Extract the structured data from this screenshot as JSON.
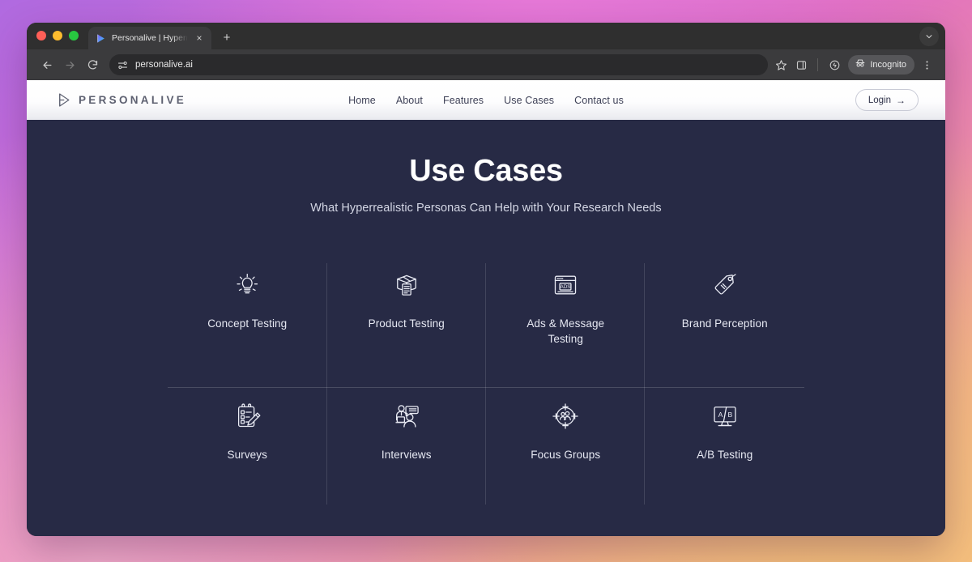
{
  "browser": {
    "window_controls": [
      "close",
      "minimize",
      "maximize"
    ],
    "tab": {
      "title": "Personalive | Hyperrealistic P",
      "favicon": "personalive-play-icon",
      "close_label": "×"
    },
    "new_tab_label": "+",
    "tab_list_chevron": "chevron-down-icon",
    "toolbar": {
      "back_label": "←",
      "forward_label": "→",
      "reload_label": "⟳",
      "site_settings_icon": "tune-icon",
      "url": "personalive.ai",
      "bookmark_icon": "star-icon",
      "side_panel_icon": "side-panel-icon",
      "extensions_icon": "extensions-icon",
      "incognito_label": "Incognito",
      "incognito_icon": "incognito-hat-icon",
      "menu_label": "⋮"
    }
  },
  "site": {
    "logo": {
      "mark": "play-triangle-icon",
      "text": "PERSONALIVE"
    },
    "nav": [
      {
        "label": "Home"
      },
      {
        "label": "About"
      },
      {
        "label": "Features"
      },
      {
        "label": "Use Cases"
      },
      {
        "label": "Contact us"
      }
    ],
    "login": {
      "label": "Login",
      "arrow": "→"
    }
  },
  "hero": {
    "title": "Use Cases",
    "subtitle": "What Hyperrealistic Personas Can Help with Your Research Needs"
  },
  "use_cases": [
    {
      "label": "Concept Testing",
      "icon": "lightbulb-icon"
    },
    {
      "label": "Product Testing",
      "icon": "box-clipboard-icon"
    },
    {
      "label": "Ads & Message Testing",
      "icon": "browser-ads-icon"
    },
    {
      "label": "Brand Perception",
      "icon": "price-tag-icon"
    },
    {
      "label": "Surveys",
      "icon": "clipboard-pencil-icon"
    },
    {
      "label": "Interviews",
      "icon": "people-speech-bubble-icon"
    },
    {
      "label": "Focus Groups",
      "icon": "target-group-icon"
    },
    {
      "label": "A/B Testing",
      "icon": "monitor-ab-icon"
    }
  ],
  "colors": {
    "page_background": "#272a45",
    "header_background": "#ffffff",
    "text_primary": "#ffffff",
    "text_secondary": "#d3d6e4",
    "browser_chrome": "#3b3b3d",
    "gradient_start": "#b06ae0",
    "gradient_end": "#f2bd84"
  }
}
